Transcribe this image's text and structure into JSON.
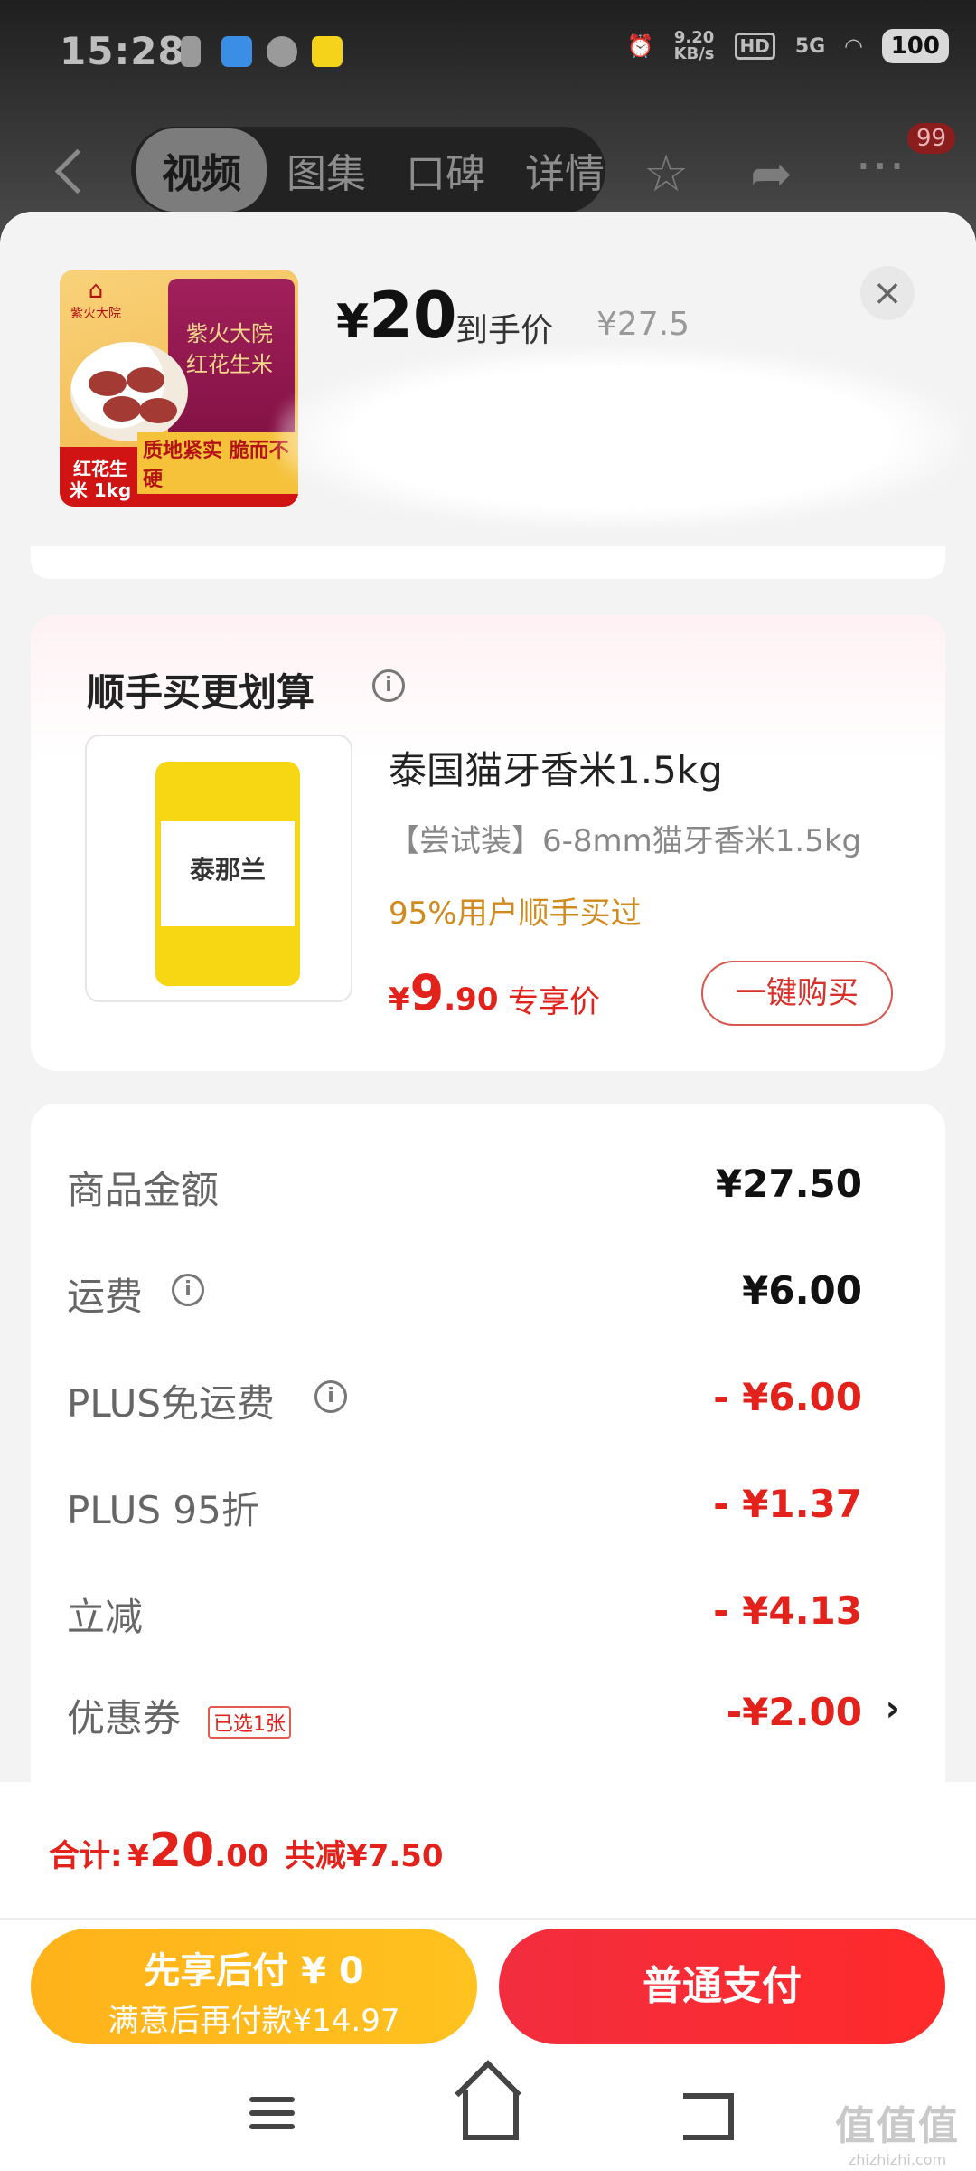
{
  "status_bar": {
    "time": "15:28",
    "net_speed_value": "9.20",
    "net_speed_unit": "KB/s",
    "hd": "HD",
    "signal": "5G",
    "battery": "100"
  },
  "nav": {
    "tabs": [
      {
        "label": "视频",
        "active": true
      },
      {
        "label": "图集"
      },
      {
        "label": "口碑"
      },
      {
        "label": "详情"
      }
    ],
    "badge_count": "99"
  },
  "sheet": {
    "price_symbol": "¥",
    "price_value": "20",
    "price_label": "到手价",
    "original_price": "¥27.5",
    "close_icon": "×",
    "thumb": {
      "brand": "紫火大院",
      "bag_text": "紫火大院 红花生米",
      "tag_left": "红花生米 1kg",
      "tag_right": "质地紧实 脆而不硬"
    }
  },
  "addon": {
    "title": "顺手买更划算",
    "info_icon": "i",
    "product_name": "泰国猫牙香米1.5kg",
    "product_spec": "【尝试装】6-8mm猫牙香米1.5kg",
    "note": "95%用户顺手买过",
    "price_symbol": "¥",
    "price_int": "9",
    "price_dec": ".90",
    "price_label": "专享价",
    "buy_button": "一键购买",
    "bag_brand": "泰那兰"
  },
  "summary": {
    "rows": [
      {
        "label": "商品金额",
        "value": "¥27.50"
      },
      {
        "label": "运费",
        "value": "¥6.00"
      },
      {
        "label": "PLUS免运费",
        "value": "- ¥6.00"
      },
      {
        "label": "PLUS 95折",
        "value": "- ¥1.37"
      },
      {
        "label": "立减",
        "value": "- ¥4.13"
      },
      {
        "label": "优惠券",
        "value": "-¥2.00",
        "tag": "已选1张"
      }
    ]
  },
  "footer": {
    "total_label": "合计:",
    "total_symbol": "¥",
    "total_int": "20",
    "total_dec": ".00",
    "total_saved": "共减¥7.50",
    "pay_later_line1": "先享后付 ¥ 0",
    "pay_later_line2": "满意后再付款¥14.97",
    "pay_button": "普通支付"
  },
  "watermark": {
    "top": "值值值",
    "bottom": "zhizhizhi.com"
  },
  "colors": {
    "accent_red": "#e3231b",
    "pay_later_yellow": "#ffb21a",
    "note_orange": "#d08a1d"
  }
}
